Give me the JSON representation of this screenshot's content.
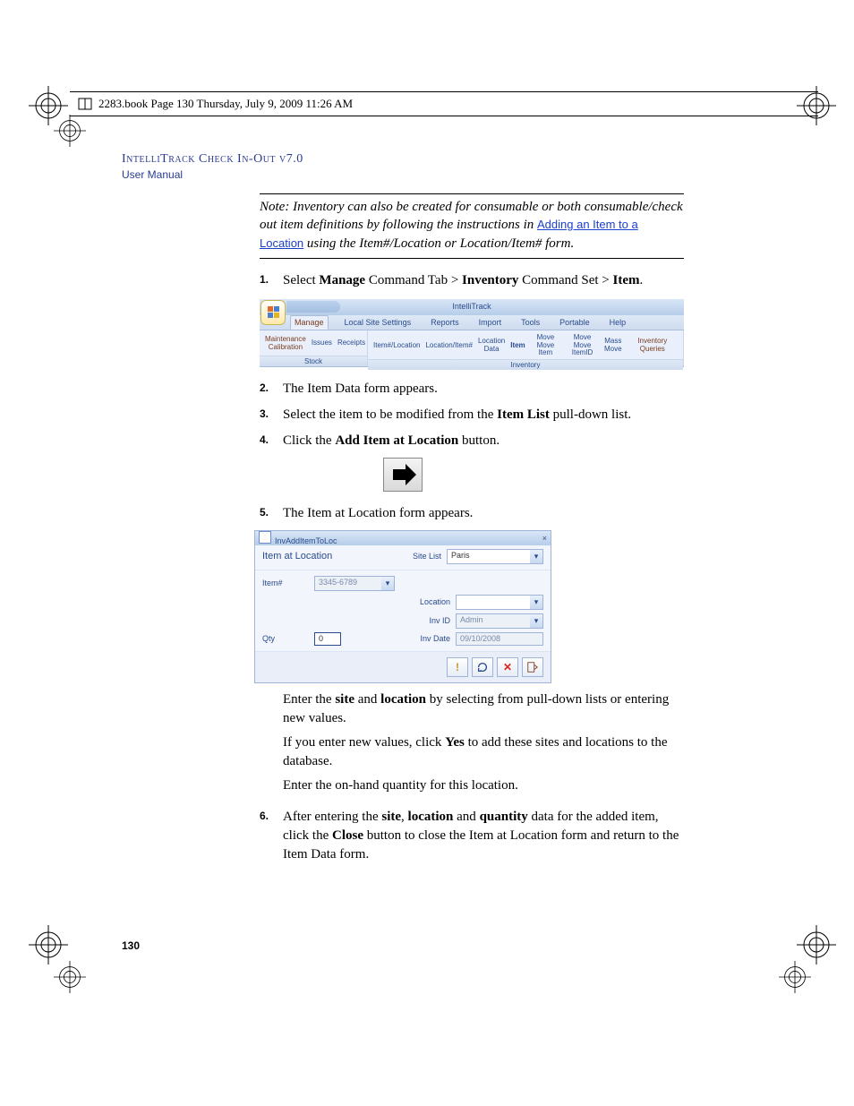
{
  "crop_header": "2283.book  Page 130  Thursday, July 9, 2009  11:26 AM",
  "run_head1": "IntelliTrack Check In-Out v7.0",
  "run_head2": "User Manual",
  "note": {
    "prefix": "Note:   Inventory can also be created for consumable or both consumable/check out item definitions by following the instructions in ",
    "link": "Adding an Item to a Location",
    "suffix": " using the Item#/Location or Location/Item# form."
  },
  "steps": {
    "s1": {
      "num": "1.",
      "text_pre": "Select ",
      "b1": "Manage",
      "mid1": " Command Tab > ",
      "b2": "Inventory",
      "mid2": "  Command Set > ",
      "b3": "Item",
      "post": "."
    },
    "s2": {
      "num": "2.",
      "text": "The Item Data form appears."
    },
    "s3": {
      "num": "3.",
      "text_pre": "Select the item to be modified from the ",
      "b1": "Item List",
      "post": " pull-down list."
    },
    "s4": {
      "num": "4.",
      "text_pre": "Click the ",
      "b1": "Add Item at Location",
      "post": " button."
    },
    "s5": {
      "num": "5.",
      "text": "The Item at Location form appears."
    },
    "s6": {
      "num": "6.",
      "text_pre": "After entering the ",
      "b1": "site",
      "mid1": ", ",
      "b2": "location",
      "mid2": " and ",
      "b3": "quantity",
      "mid3": " data for the added item, click the ",
      "b4": "Close",
      "post": " button to close the Item at Location form and return to the Item Data form."
    }
  },
  "sub_paras": {
    "p1_pre": "Enter the ",
    "p1_b1": "site",
    "p1_mid": " and ",
    "p1_b2": "location",
    "p1_post": " by selecting from pull-down lists or entering new values.",
    "p2_pre": "If you enter new values, click ",
    "p2_b1": "Yes",
    "p2_post": " to add these sites and locations to the database.",
    "p3": "Enter the on-hand quantity for this location."
  },
  "ribbon": {
    "title": "IntelliTrack",
    "tabs": [
      "Manage",
      "Local Site Settings",
      "Reports",
      "Import",
      "Tools",
      "Portable",
      "Help"
    ],
    "group1": {
      "label": "Stock",
      "items": [
        "Maintenance\nCalibration",
        "Issues",
        "Receipts"
      ]
    },
    "group2": {
      "label": "Inventory",
      "items": [
        "Item#/Location",
        "Location/Item#",
        "Location\nData",
        "Item",
        "Move\nMove Item",
        "Move Move\nItemID",
        "Mass\nMove",
        "Inventory Queries"
      ]
    }
  },
  "dialog": {
    "win_title": "InvAddItemToLoc",
    "title": "Item at Location",
    "site_list_lbl": "Site List",
    "site_list_val": "Paris",
    "labels": {
      "item": "Item#",
      "location": "Location",
      "inv_id": "Inv ID",
      "qty": "Qty",
      "inv_date": "Inv Date"
    },
    "values": {
      "item": "3345-6789",
      "location": "",
      "inv_id": "Admin",
      "qty": "0",
      "inv_date": "09/10/2008"
    }
  },
  "page_number": "130"
}
